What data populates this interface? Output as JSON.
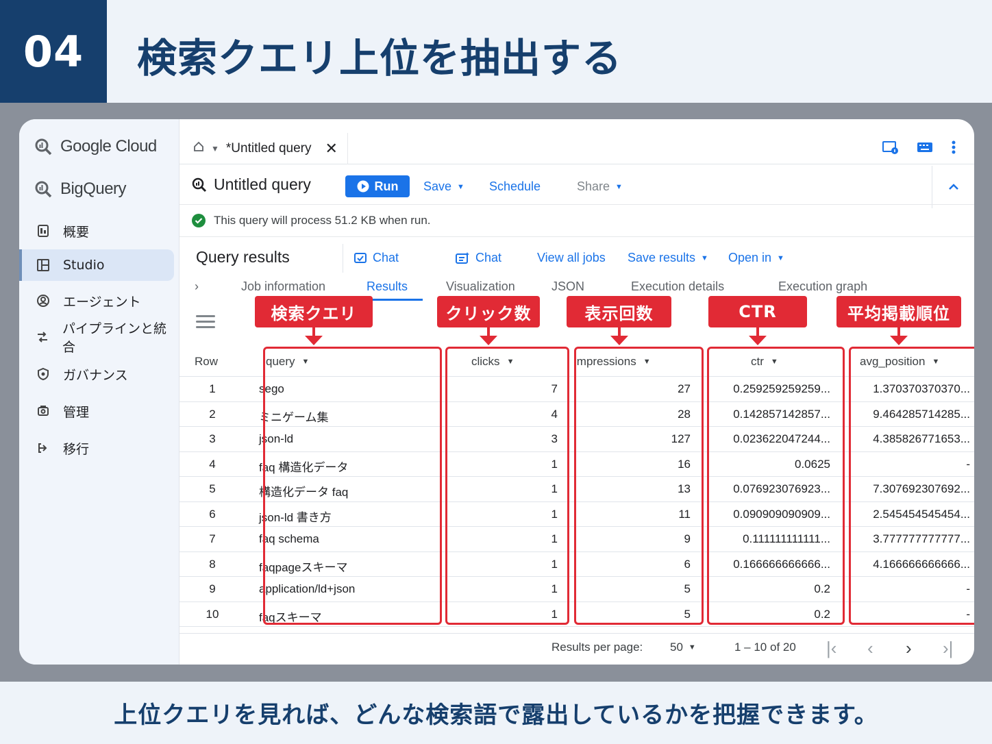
{
  "banner": {
    "step": "04",
    "title": "検索クエリ上位を抽出する"
  },
  "sidebar": {
    "brand": "Google Cloud",
    "product": "BigQuery",
    "items": [
      {
        "label": "概要",
        "icon": "overview-icon"
      },
      {
        "label": "Studio",
        "icon": "studio-icon",
        "active": true
      },
      {
        "label": "エージェント",
        "icon": "agent-icon"
      },
      {
        "label": "パイプラインと統合",
        "icon": "pipeline-icon"
      },
      {
        "label": "ガバナンス",
        "icon": "governance-icon"
      },
      {
        "label": "管理",
        "icon": "admin-icon"
      },
      {
        "label": "移行",
        "icon": "migration-icon"
      }
    ]
  },
  "tabbar": {
    "tab_label": "*Untitled query"
  },
  "toolbar": {
    "title": "Untitled query",
    "run": "Run",
    "save": "Save",
    "schedule": "Schedule",
    "share": "Share"
  },
  "validator": {
    "message": "This query will process 51.2 KB when run."
  },
  "results": {
    "title": "Query results",
    "chat1": "Chat",
    "chat2": "Chat",
    "view_all_jobs": "View all jobs",
    "save_results": "Save results",
    "open_in": "Open in",
    "subtabs": [
      "Job information",
      "Results",
      "Visualization",
      "JSON",
      "Execution details",
      "Execution graph"
    ],
    "active_subtab": "Results"
  },
  "annotations": {
    "query": "検索クエリ",
    "clicks": "クリック数",
    "impressions": "表示回数",
    "ctr": "CTR",
    "avg_position": "平均掲載順位"
  },
  "table": {
    "headers": {
      "row": "Row",
      "query": "query",
      "clicks": "clicks",
      "impressions": "impressions",
      "ctr": "ctr",
      "avg_position": "avg_position"
    },
    "rows": [
      {
        "row": "1",
        "query": "sego",
        "clicks": "7",
        "impressions": "27",
        "ctr": "0.259259259259...",
        "avg_position": "1.370370370370..."
      },
      {
        "row": "2",
        "query": "ミニゲーム集",
        "clicks": "4",
        "impressions": "28",
        "ctr": "0.142857142857...",
        "avg_position": "9.464285714285..."
      },
      {
        "row": "3",
        "query": "json-ld",
        "clicks": "3",
        "impressions": "127",
        "ctr": "0.023622047244...",
        "avg_position": "4.385826771653..."
      },
      {
        "row": "4",
        "query": "faq 構造化データ",
        "clicks": "1",
        "impressions": "16",
        "ctr": "0.0625",
        "avg_position": "-"
      },
      {
        "row": "5",
        "query": "構造化データ faq",
        "clicks": "1",
        "impressions": "13",
        "ctr": "0.076923076923...",
        "avg_position": "7.307692307692..."
      },
      {
        "row": "6",
        "query": "json-ld 書き方",
        "clicks": "1",
        "impressions": "11",
        "ctr": "0.090909090909...",
        "avg_position": "2.545454545454..."
      },
      {
        "row": "7",
        "query": "faq schema",
        "clicks": "1",
        "impressions": "9",
        "ctr": "0.111111111111...",
        "avg_position": "3.777777777777..."
      },
      {
        "row": "8",
        "query": "faqpageスキーマ",
        "clicks": "1",
        "impressions": "6",
        "ctr": "0.166666666666...",
        "avg_position": "4.166666666666..."
      },
      {
        "row": "9",
        "query": "application/ld+json",
        "clicks": "1",
        "impressions": "5",
        "ctr": "0.2",
        "avg_position": "-"
      },
      {
        "row": "10",
        "query": "faqスキーマ",
        "clicks": "1",
        "impressions": "5",
        "ctr": "0.2",
        "avg_position": "-"
      }
    ]
  },
  "pagination": {
    "per_page_label": "Results per page:",
    "per_page_value": "50",
    "range": "1 – 10 of 20"
  },
  "caption": "上位クエリを見れば、どんな検索語で露出しているかを把握できます。",
  "colors": {
    "navy": "#163f6d",
    "accent_red": "#e12a35",
    "link_blue": "#1a73e8"
  }
}
